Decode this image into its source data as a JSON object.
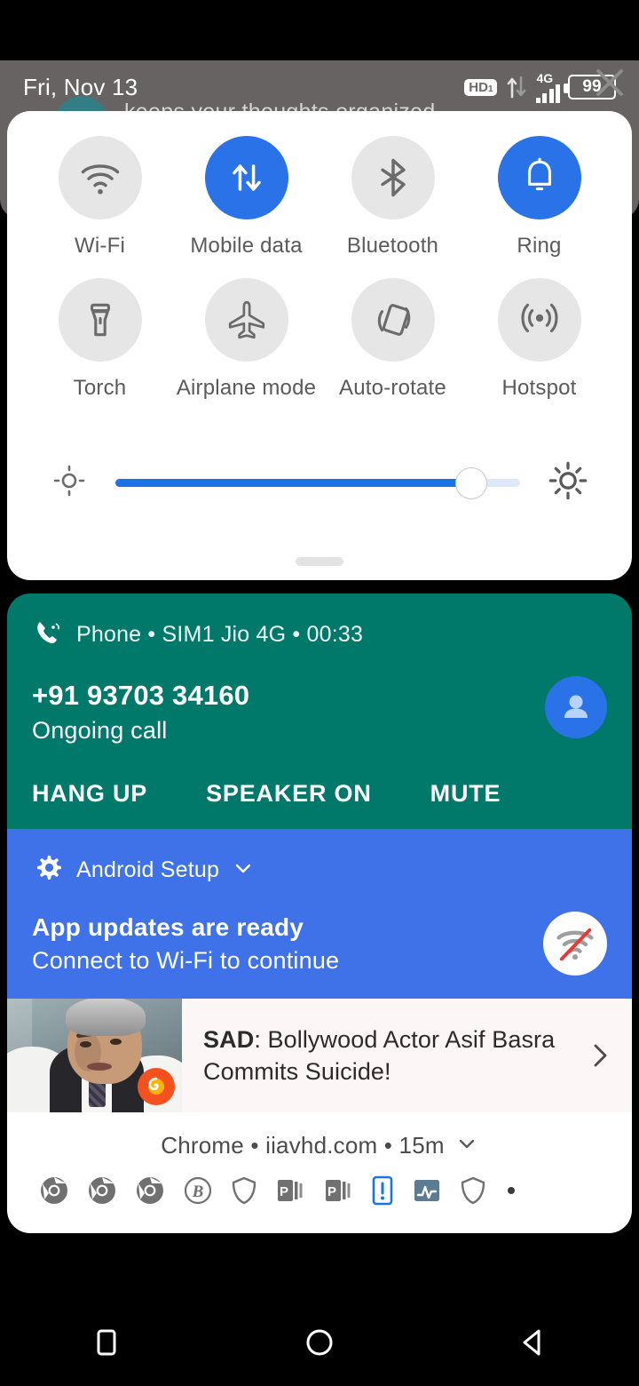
{
  "status_bar": {
    "date": "Fri, Nov 13",
    "hd_label": "HD",
    "hd_sub": "1",
    "network_type": "4G",
    "battery_level": "99",
    "signal_bars": 4,
    "icons": {
      "data_arrows": "data-transfer-icon",
      "signal": "signal-bars-icon",
      "battery": "battery-icon",
      "close": "close-icon"
    }
  },
  "background_notification": {
    "text": "keeps your thoughts organized"
  },
  "quick_settings": {
    "row1": [
      {
        "label": "Wi-Fi",
        "icon": "wifi-icon",
        "active": false
      },
      {
        "label": "Mobile data",
        "icon": "mobile-data-icon",
        "active": true
      },
      {
        "label": "Bluetooth",
        "icon": "bluetooth-icon",
        "active": false
      },
      {
        "label": "Ring",
        "icon": "ring-bell-icon",
        "active": true
      }
    ],
    "row2": [
      {
        "label": "Torch",
        "icon": "torch-icon",
        "active": false
      },
      {
        "label": "Airplane mode",
        "icon": "airplane-icon",
        "active": false
      },
      {
        "label": "Auto-rotate",
        "icon": "auto-rotate-icon",
        "active": false
      },
      {
        "label": "Hotspot",
        "icon": "hotspot-icon",
        "active": false
      }
    ],
    "brightness": {
      "value_percent": 88,
      "low_icon": "brightness-low-icon",
      "high_icon": "brightness-high-icon"
    },
    "accent_color": "#2a72e8",
    "inactive_color": "#e6e6e6"
  },
  "notifications": {
    "call": {
      "app": "Phone",
      "header": "Phone • SIM1 Jio 4G • 00:33",
      "sim": "SIM1 Jio 4G",
      "duration": "00:33",
      "number": "+91 93703 34160",
      "state": "Ongoing call",
      "actions": [
        "HANG UP",
        "SPEAKER ON",
        "MUTE"
      ],
      "background_color": "#00796b",
      "icon": "phone-call-icon",
      "avatar_icon": "person-avatar-icon",
      "collapse_icon": "chevron-up-icon"
    },
    "setup": {
      "app": "Android Setup",
      "title": "App updates are ready",
      "subtitle": "Connect to Wi-Fi to continue",
      "background_color": "#3f71e8",
      "icon": "gear-icon",
      "expand_icon": "chevron-down-icon",
      "badge_icon": "wifi-off-icon"
    },
    "news": {
      "headline_prefix": "SAD",
      "headline": ": Bollywood Actor Asif Basra Commits Suicide!",
      "thumbnail": "news-thumbnail-image",
      "arrow_icon": "chevron-right-icon"
    },
    "chrome": {
      "header": "Chrome • iiavhd.com • 15m",
      "app": "Chrome",
      "site": "iiavhd.com",
      "time": "15m",
      "expand_icon": "chevron-down-icon",
      "collapsed_icons": [
        "chrome-icon",
        "chrome-icon",
        "chrome-icon",
        "b-circle-icon",
        "shield-icon",
        "p-app-icon",
        "p-app-icon",
        "phone-alert-icon",
        "pulse-chart-icon",
        "shield-icon",
        "more-dot-icon"
      ]
    }
  },
  "nav_bar": {
    "recents": "recents-square-icon",
    "home": "home-circle-icon",
    "back": "back-triangle-icon"
  }
}
